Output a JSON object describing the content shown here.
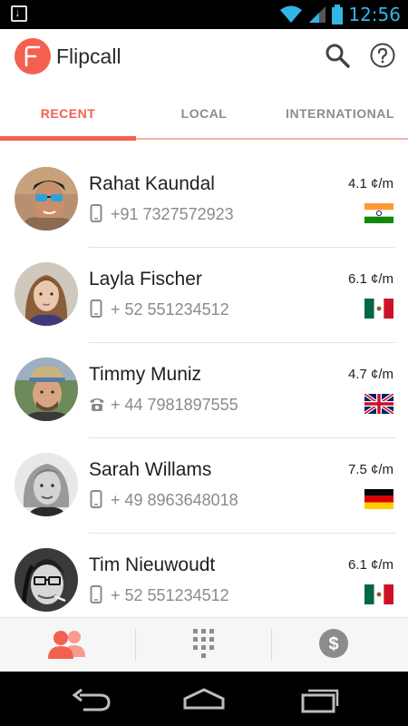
{
  "status_bar": {
    "time": "12:56",
    "icons": [
      "download-icon",
      "wifi-icon",
      "signal-icon",
      "battery-icon"
    ]
  },
  "app_bar": {
    "title": "Flipcall",
    "icons": [
      "search-icon",
      "help-icon"
    ],
    "accent_color": "#f4604f"
  },
  "tabs": [
    {
      "label": "RECENT",
      "active": true
    },
    {
      "label": "LOCAL",
      "active": false
    },
    {
      "label": "INTERNATIONAL",
      "active": false
    }
  ],
  "contacts": [
    {
      "name": "Rahat Kaundal",
      "number": "+91 7327572923",
      "rate": "4.1 ¢/m",
      "phone_type": "mobile-phone-icon",
      "flag": "india-flag-icon"
    },
    {
      "name": "Layla Fischer",
      "number": "+ 52 551234512",
      "rate": "6.1 ¢/m",
      "phone_type": "mobile-phone-icon",
      "flag": "mexico-flag-icon"
    },
    {
      "name": "Timmy Muniz",
      "number": "+ 44 7981897555",
      "rate": "4.7 ¢/m",
      "phone_type": "landline-phone-icon",
      "flag": "uk-flag-icon"
    },
    {
      "name": "Sarah Willams",
      "number": "+ 49 8963648018",
      "rate": "7.5 ¢/m",
      "phone_type": "mobile-phone-icon",
      "flag": "germany-flag-icon"
    },
    {
      "name": "Tim Nieuwoudt",
      "number": "+ 52 551234512",
      "rate": "6.1 ¢/m",
      "phone_type": "mobile-phone-icon",
      "flag": "mexico-flag-icon"
    }
  ],
  "bottom_nav": {
    "items": [
      "contacts-icon",
      "dialpad-icon",
      "dollar-icon"
    ],
    "active": "contacts-icon"
  },
  "system_nav": {
    "items": [
      "back-icon",
      "home-icon",
      "recents-icon"
    ]
  }
}
